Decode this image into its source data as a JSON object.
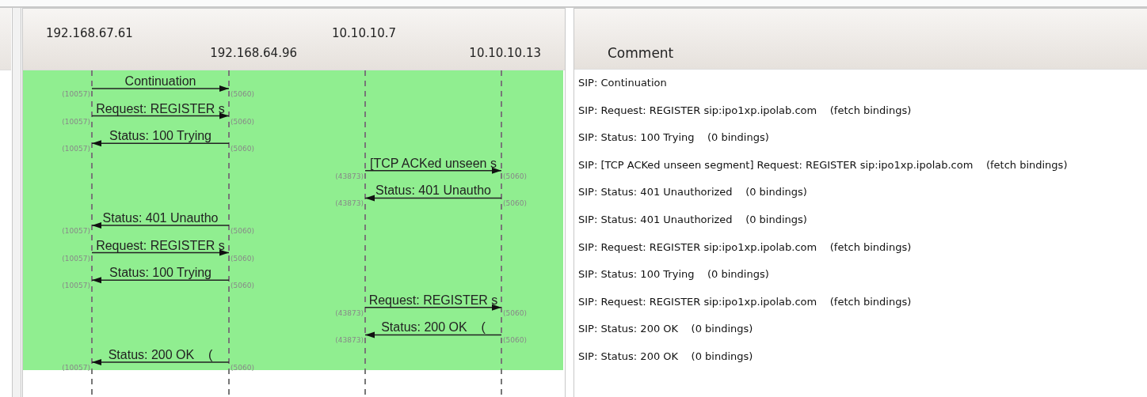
{
  "flow": {
    "nodes": [
      {
        "label": "192.168.67.61"
      },
      {
        "label": "192.168.64.96"
      },
      {
        "label": "10.10.10.7"
      },
      {
        "label": "10.10.10.13"
      }
    ],
    "messages": [
      {
        "second_pair": false,
        "kind": "rightward",
        "label": "Continuation",
        "left_port": "(10057)",
        "right_port": "(5060)"
      },
      {
        "second_pair": false,
        "kind": "rightward",
        "label": "Request: REGISTER s",
        "left_port": "(10057)",
        "right_port": "(5060)"
      },
      {
        "second_pair": false,
        "kind": "leftward",
        "label": "Status: 100 Trying",
        "left_port": "(10057)",
        "right_port": "(5060)"
      },
      {
        "second_pair": true,
        "kind": "rightward",
        "label": "[TCP ACKed unseen s",
        "left_port": "(43873)",
        "right_port": "(5060)"
      },
      {
        "second_pair": true,
        "kind": "leftward",
        "label": "Status: 401 Unautho",
        "left_port": "(43873)",
        "right_port": "(5060)"
      },
      {
        "second_pair": false,
        "kind": "leftward",
        "label": "Status: 401 Unautho",
        "left_port": "(10057)",
        "right_port": "(5060)"
      },
      {
        "second_pair": false,
        "kind": "rightward",
        "label": "Request: REGISTER s",
        "left_port": "(10057)",
        "right_port": "(5060)"
      },
      {
        "second_pair": false,
        "kind": "leftward",
        "label": "Status: 100 Trying",
        "left_port": "(10057)",
        "right_port": "(5060)"
      },
      {
        "second_pair": true,
        "kind": "rightward",
        "label": "Request: REGISTER s",
        "left_port": "(43873)",
        "right_port": "(5060)"
      },
      {
        "second_pair": true,
        "kind": "leftward",
        "label": "Status: 200 OK    (",
        "left_port": "(43873)",
        "right_port": "(5060)"
      },
      {
        "second_pair": false,
        "kind": "leftward",
        "label": "Status: 200 OK    (",
        "left_port": "(10057)",
        "right_port": "(5060)"
      }
    ]
  },
  "comment_column": {
    "heading": "Comment",
    "rows": [
      "SIP: Continuation",
      "SIP: Request: REGISTER sip:ipo1xp.ipolab.com    (fetch bindings)",
      "SIP: Status: 100 Trying    (0 bindings)",
      "SIP: [TCP ACKed unseen segment] Request: REGISTER sip:ipo1xp.ipolab.com    (fetch bindings)",
      "SIP: Status: 401 Unauthorized    (0 bindings)",
      "SIP: Status: 401 Unauthorized    (0 bindings)",
      "SIP: Request: REGISTER sip:ipo1xp.ipolab.com    (fetch bindings)",
      "SIP: Status: 100 Trying    (0 bindings)",
      "SIP: Request: REGISTER sip:ipo1xp.ipolab.com    (fetch bindings)",
      "SIP: Status: 200 OK    (0 bindings)",
      "SIP: Status: 200 OK    (0 bindings)"
    ]
  }
}
